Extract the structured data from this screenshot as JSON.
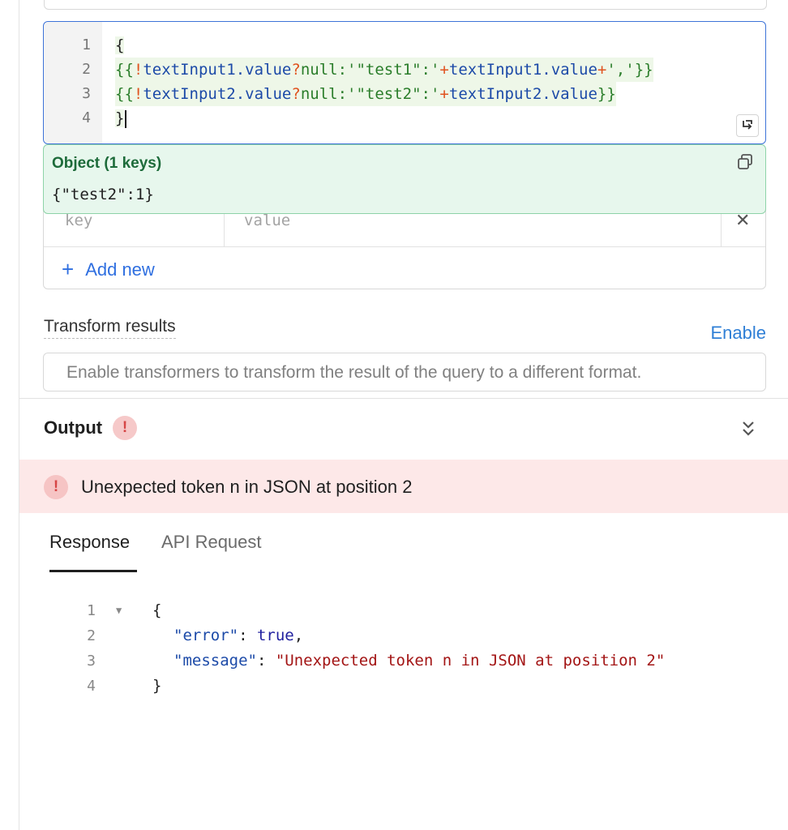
{
  "editor": {
    "lines": [
      {
        "num": "1",
        "p1": "{",
        "p2": "",
        "p3": "",
        "p4": "",
        "p5": "",
        "p6": "",
        "p7": "",
        "p8": "",
        "p9": ""
      },
      {
        "num": "2",
        "p1": "{{",
        "p2": "!",
        "p3": "textInput1.value",
        "p4": "?",
        "p5": "null:",
        "p6": "'\"test1\":'",
        "p7": "+",
        "p8": "textInput1.value",
        "p9": "+",
        "p10": "','",
        "p11": "}}"
      },
      {
        "num": "3",
        "p1": "{{",
        "p2": "!",
        "p3": "textInput2.value",
        "p4": "?",
        "p5": "null:",
        "p6": "'\"test2\":'",
        "p7": "+",
        "p8": "textInput2.value",
        "p9": "}}"
      },
      {
        "num": "4",
        "p1": "}"
      }
    ]
  },
  "preview": {
    "title": "Object (1 keys)",
    "value": "{\"test2\":1}"
  },
  "params": {
    "key_placeholder": "key",
    "value_placeholder": "value",
    "remove_label": "✕",
    "add_new_label": "Add new",
    "add_new_icon": "+"
  },
  "transform": {
    "label": "Transform results",
    "enable_label": "Enable",
    "description": "Enable transformers to transform the result of the query to a different format."
  },
  "output": {
    "title": "Output",
    "badge": "!",
    "error_message": "Unexpected token n in JSON at position 2"
  },
  "tabs": {
    "response": "Response",
    "api_request": "API Request"
  },
  "response": {
    "l1_num": "1",
    "l1_text": "{",
    "l2_num": "2",
    "l2_key": "\"error\"",
    "l2_sep": ": ",
    "l2_val": "true",
    "l2_end": ",",
    "l3_num": "3",
    "l3_key": "\"message\"",
    "l3_sep": ": ",
    "l3_val": "\"Unexpected token n in JSON at position 2\"",
    "l4_num": "4",
    "l4_text": "}",
    "fold_icon": "▼"
  },
  "colors": {
    "accent": "#3d73d8",
    "success_bg": "#e7f7ed",
    "error_bg": "#fde8e8",
    "link": "#2f6fe0"
  }
}
